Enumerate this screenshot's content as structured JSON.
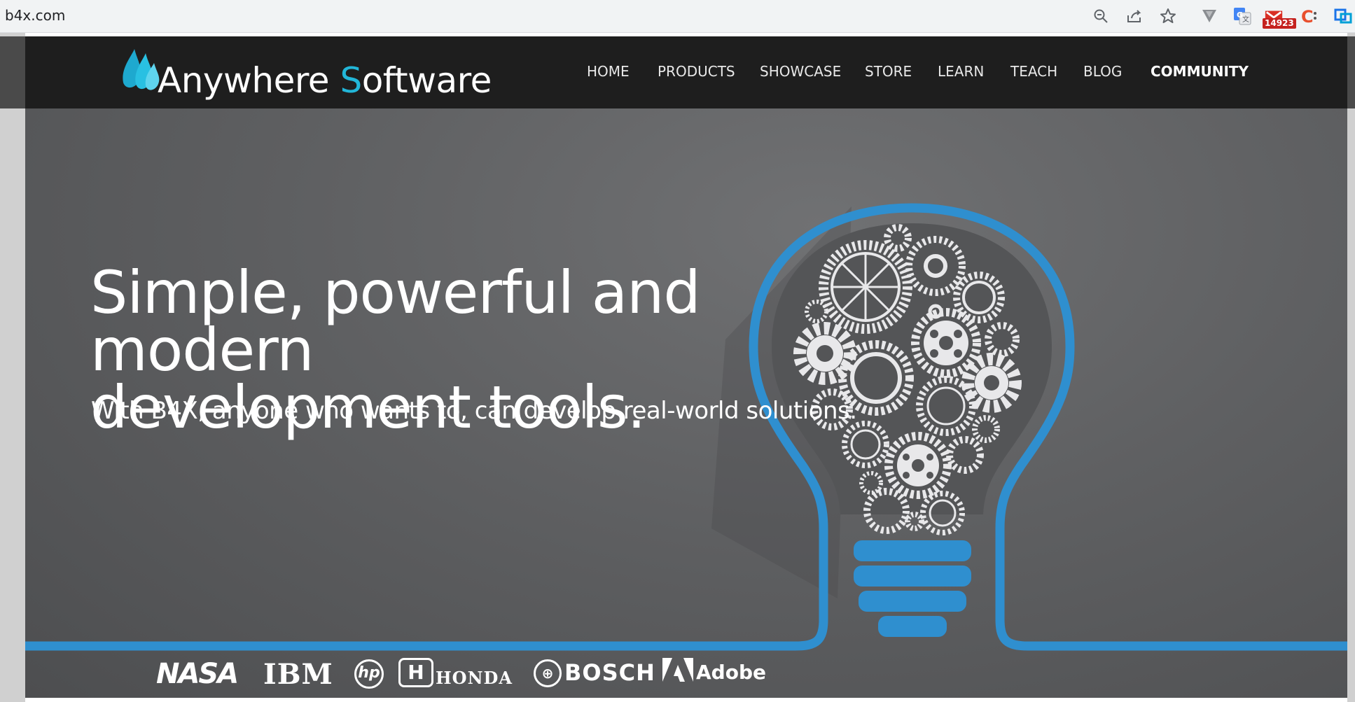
{
  "browser": {
    "url": "b4x.com",
    "icons": [
      "zoom-icon",
      "share-icon",
      "star-icon",
      "vimium-extension-icon",
      "translate-extension-icon",
      "gmail-extension-icon",
      "c-extension-icon",
      "screen-capture-extension-icon"
    ],
    "gmail_badge": "14923"
  },
  "header": {
    "logo_main": "Anywhere ",
    "logo_accent_letter": "S",
    "logo_rest": "oftware",
    "nav": {
      "home": "HOME",
      "products": "PRODUCTS",
      "showcase": "SHOWCASE",
      "store": "STORE",
      "learn": "LEARN",
      "teach": "TEACH",
      "blog": "BLOG",
      "community": "COMMUNITY"
    }
  },
  "hero": {
    "title_line1": "Simple, powerful and modern",
    "title_line2": "development tools.",
    "subtitle": "With B4X, anyone who wants to, can develop real-world solutions."
  },
  "clients": {
    "nasa": "NASA",
    "ibm": "IBM",
    "hp": "hp",
    "honda_mark": "H",
    "honda": "HONDA",
    "bosch": "BOSCH",
    "adobe": "Adobe"
  },
  "colors": {
    "accent": "#22b6d8",
    "bulb_blue": "#2f8fcf",
    "header_bg": "#1e1e1e"
  }
}
